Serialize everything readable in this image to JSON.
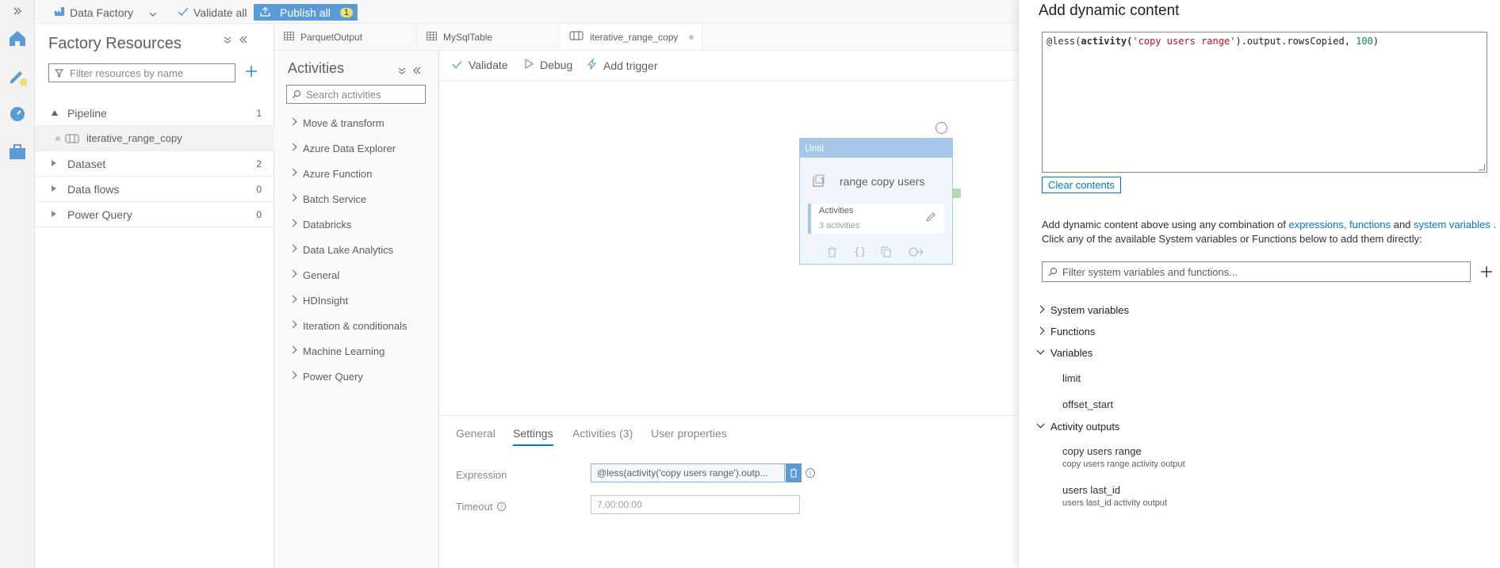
{
  "topbar": {
    "factory": "Data Factory",
    "validate_all": "Validate all",
    "publish_all": "Publish all",
    "publish_count": "1"
  },
  "resources": {
    "title": "Factory Resources",
    "filter_placeholder": "Filter resources by name",
    "items": [
      {
        "label": "Pipeline",
        "count": "1"
      },
      {
        "label": "iterative_range_copy",
        "count": ""
      },
      {
        "label": "Dataset",
        "count": "2"
      },
      {
        "label": "Data flows",
        "count": "0"
      },
      {
        "label": "Power Query",
        "count": "0"
      }
    ]
  },
  "tabs": [
    {
      "label": "ParquetOutput"
    },
    {
      "label": "MySqlTable"
    },
    {
      "label": "iterative_range_copy"
    }
  ],
  "activities": {
    "title": "Activities",
    "search_placeholder": "Search activities",
    "items": [
      "Move & transform",
      "Azure Data Explorer",
      "Azure Function",
      "Batch Service",
      "Databricks",
      "Data Lake Analytics",
      "General",
      "HDInsight",
      "Iteration & conditionals",
      "Machine Learning",
      "Power Query"
    ]
  },
  "canvas_toolbar": {
    "validate": "Validate",
    "debug": "Debug",
    "add_trigger": "Add trigger"
  },
  "until": {
    "header": "Until",
    "name": "range copy users",
    "inner_title": "Activities",
    "inner_sub": "3 activities"
  },
  "bottom": {
    "tabs": [
      "General",
      "Settings",
      "Activities (3)",
      "User properties"
    ],
    "expression_label": "Expression",
    "expression_value": "@less(activity('copy users range').outp...",
    "timeout_label": "Timeout",
    "timeout_placeholder": "7.00:00:00"
  },
  "dynamic": {
    "title": "Add dynamic content",
    "expr_pre": "@less(",
    "expr_fn": "activity(",
    "expr_str": "'copy users range'",
    "expr_rest": ").output.rowsCopied, ",
    "expr_num": "100",
    "expr_end": ")",
    "clear": "Clear contents",
    "help1_a": "Add dynamic content above using any combination of ",
    "help1_link1": "expressions, functions",
    "help1_and": " and ",
    "help1_link2": "system variables",
    "help1_dot": " .",
    "help2": "Click any of the available System variables or Functions below to add them directly:",
    "filter_placeholder": "Filter system variables and functions...",
    "sections": {
      "system_variables": "System variables",
      "functions": "Functions",
      "variables": "Variables",
      "activity_outputs": "Activity outputs"
    },
    "variables": [
      "limit",
      "offset_start"
    ],
    "outputs": [
      {
        "name": "copy users range",
        "desc": "copy users range activity output"
      },
      {
        "name": "users last_id",
        "desc": "users last_id activity output"
      }
    ]
  },
  "colors": {
    "accent": "#0078d4",
    "publish": "#5b9bd5",
    "until_header": "#a6c8e8",
    "string": "#c50f1f",
    "number": "#098658"
  }
}
